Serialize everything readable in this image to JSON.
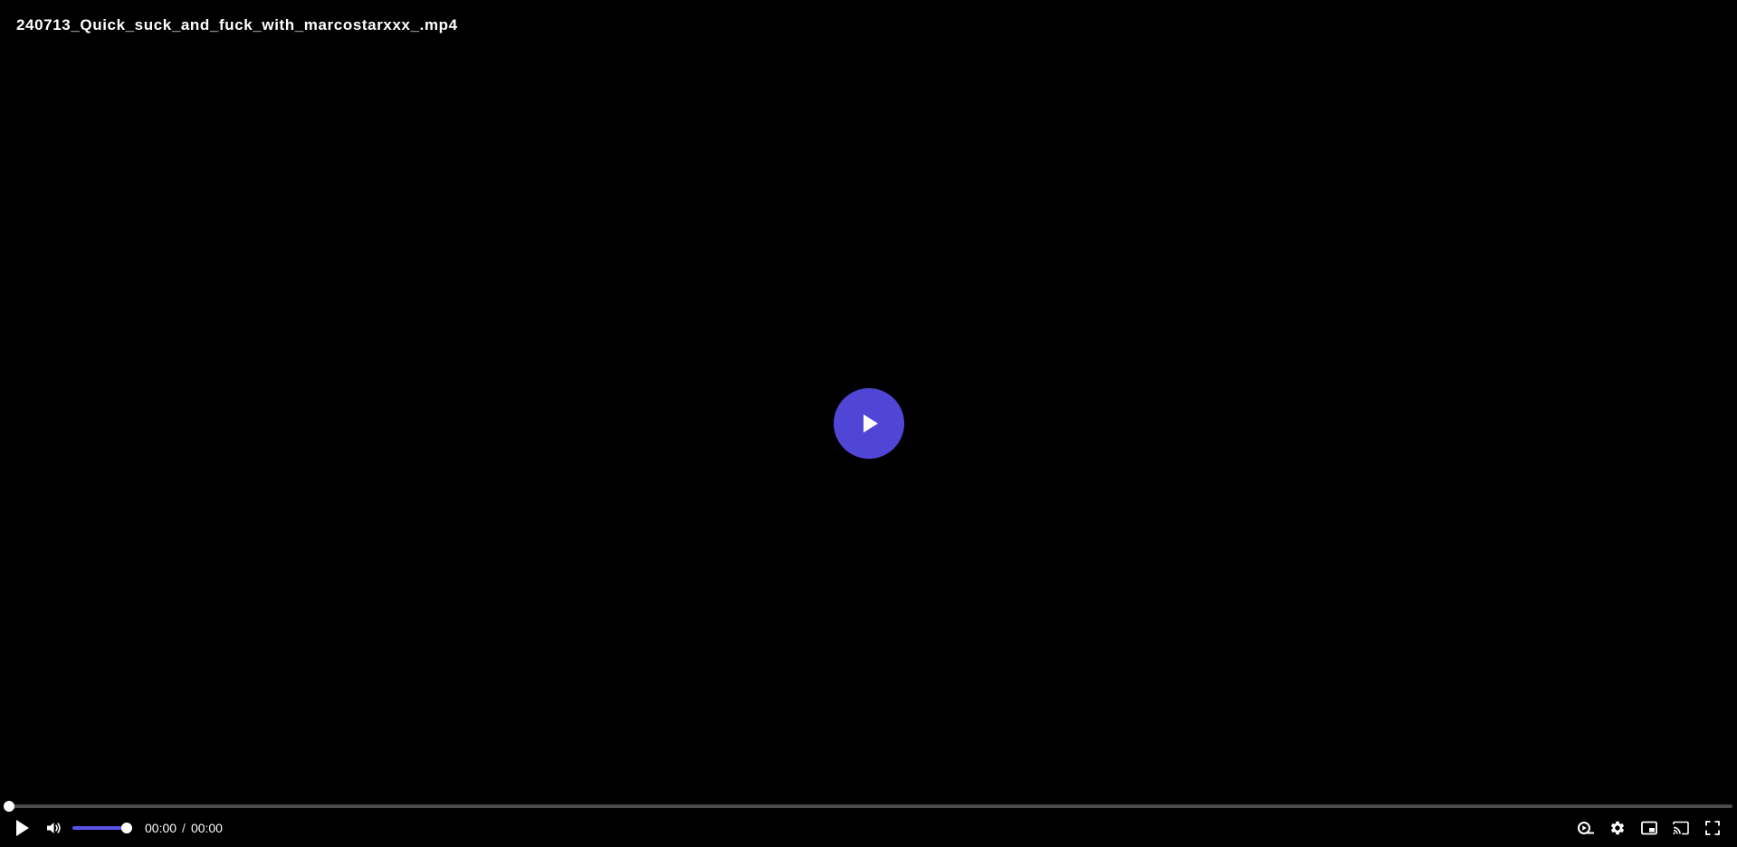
{
  "video": {
    "title": "240713_Quick_suck_and_fuck_with_marcostarxxx_.mp4"
  },
  "progress": {
    "played_fraction": 0.0
  },
  "volume": {
    "level_fraction": 1.0
  },
  "time": {
    "current": "00:00",
    "separator": "/",
    "duration": "00:00"
  },
  "icons": {
    "big_play": "play-icon",
    "play": "play-icon",
    "mute": "volume-icon",
    "speed": "playback-speed-icon",
    "settings": "gear-icon",
    "pip": "picture-in-picture-icon",
    "cast": "cast-icon",
    "fullscreen": "fullscreen-icon"
  },
  "colors": {
    "accent": "#5b52e8",
    "big_play_bg": "#5046d6",
    "track": "#4a4a4a",
    "background": "#000000"
  }
}
